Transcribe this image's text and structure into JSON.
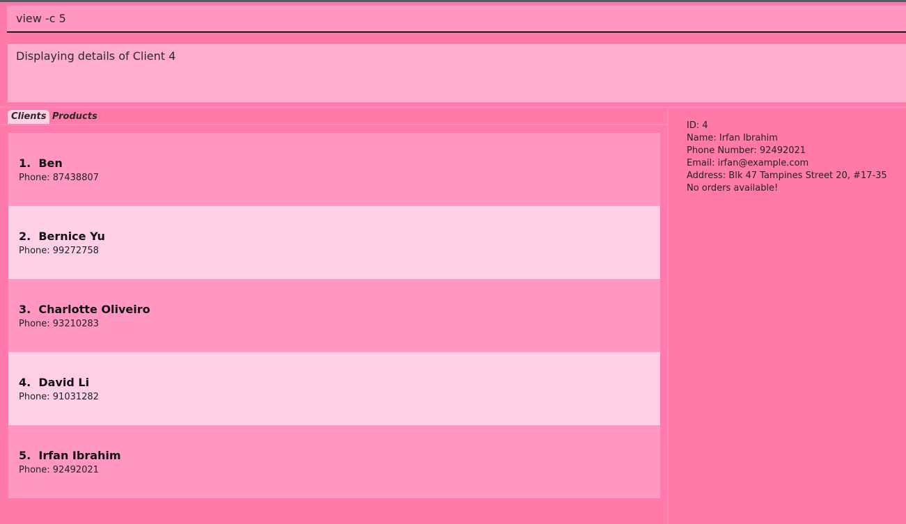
{
  "command": {
    "value": "view -c 5"
  },
  "result": {
    "text": "Displaying details of Client 4"
  },
  "tabs": [
    {
      "label": "Clients",
      "active": true
    },
    {
      "label": "Products",
      "active": false
    }
  ],
  "clients": [
    {
      "index": "1.",
      "name": "Ben",
      "phone": "Phone: 87438807"
    },
    {
      "index": "2.",
      "name": "Bernice Yu",
      "phone": "Phone: 99272758"
    },
    {
      "index": "3.",
      "name": "Charlotte Oliveiro",
      "phone": "Phone: 93210283"
    },
    {
      "index": "4.",
      "name": "David Li",
      "phone": "Phone: 91031282"
    },
    {
      "index": "5.",
      "name": "Irfan Ibrahim",
      "phone": "Phone: 92492021"
    }
  ],
  "details": {
    "id": "ID: 4",
    "name": "Name: Irfan Ibrahim",
    "phone": "Phone Number: 92492021",
    "email": "Email: irfan@example.com",
    "address": "Address: Blk 47 Tampines Street 20, #17-35",
    "orders": "No orders available!"
  },
  "colors": {
    "background": "#ff7aa8",
    "row_odd": "#ff97c1",
    "row_even": "#ffd0e3",
    "result_box": "#ffadcc"
  }
}
